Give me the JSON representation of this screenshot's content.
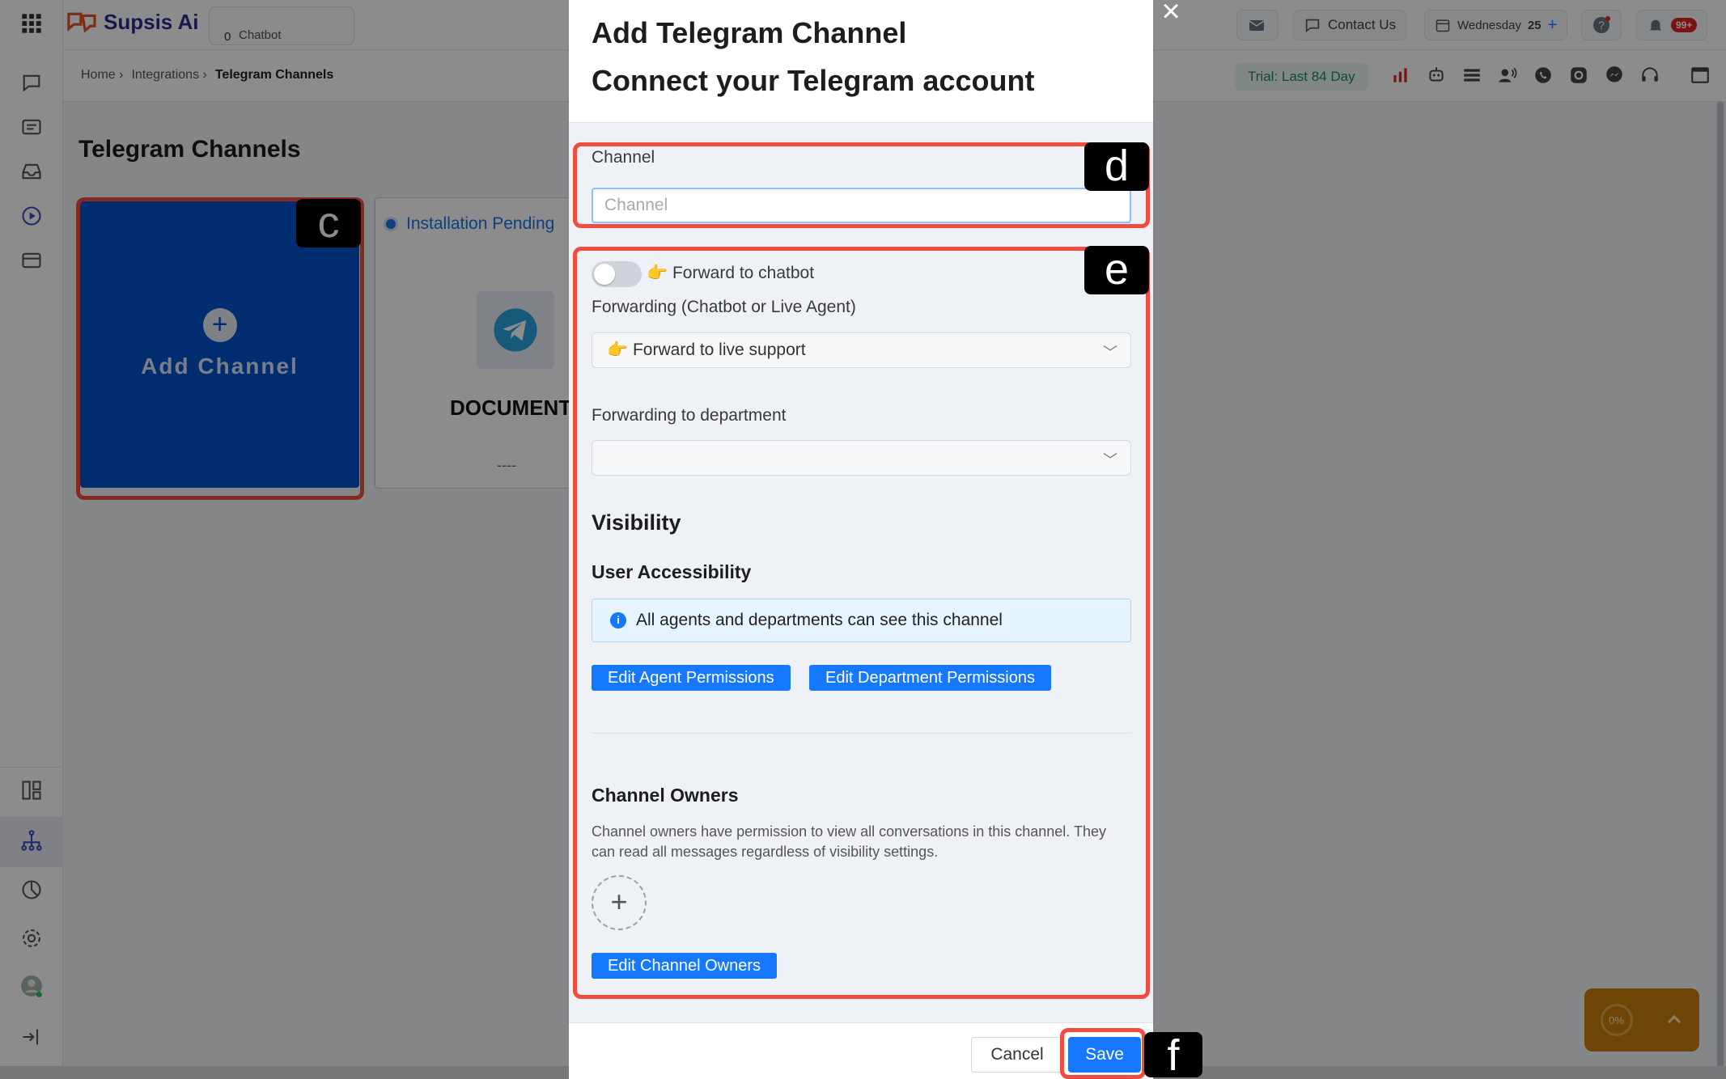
{
  "app": {
    "name": "Supsis Ai",
    "chatbot_count": "0",
    "chatbot_label": "Chatbot"
  },
  "topbar": {
    "contact_us": "Contact Us",
    "date_day": "Wednesday",
    "date_num": "25",
    "notifications_badge": "99+"
  },
  "breadcrumb": {
    "home": "Home ›",
    "integrations": "Integrations ›",
    "current": "Telegram Channels"
  },
  "trial": "Trial: Last 84 Day",
  "page": {
    "title": "Telegram Channels",
    "add_channel": "Add Channel",
    "card": {
      "status": "Installation Pending",
      "name": "DOCUMENT",
      "dash": "----"
    }
  },
  "modal": {
    "title": "Add Telegram Channel",
    "subtitle": "Connect your Telegram account",
    "channel_label": "Channel",
    "channel_placeholder": "Channel",
    "forward_toggle_label": "👉 Forward to chatbot",
    "forwarding_label": "Forwarding (Chatbot or Live Agent)",
    "forwarding_value": "👉 Forward to live support",
    "department_label": "Forwarding to department",
    "department_value": "",
    "visibility_title": "Visibility",
    "user_access_title": "User Accessibility",
    "info_text": "All agents and departments can see this channel",
    "edit_agent_btn": "Edit Agent Permissions",
    "edit_dept_btn": "Edit Department Permissions",
    "owners_title": "Channel Owners",
    "owners_desc": "Channel owners have permission to view all conversations in this channel. They can read all messages regardless of visibility settings.",
    "edit_owners_btn": "Edit Channel Owners",
    "cancel": "Cancel",
    "save": "Save"
  },
  "annotations": {
    "c": "c",
    "d": "d",
    "e": "e",
    "f": "f"
  },
  "widget": {
    "progress": "0%",
    "progress_value": 0
  },
  "colors": {
    "primary": "#1677ff",
    "card_blue": "#0052cc",
    "highlight": "#f24b3f"
  }
}
